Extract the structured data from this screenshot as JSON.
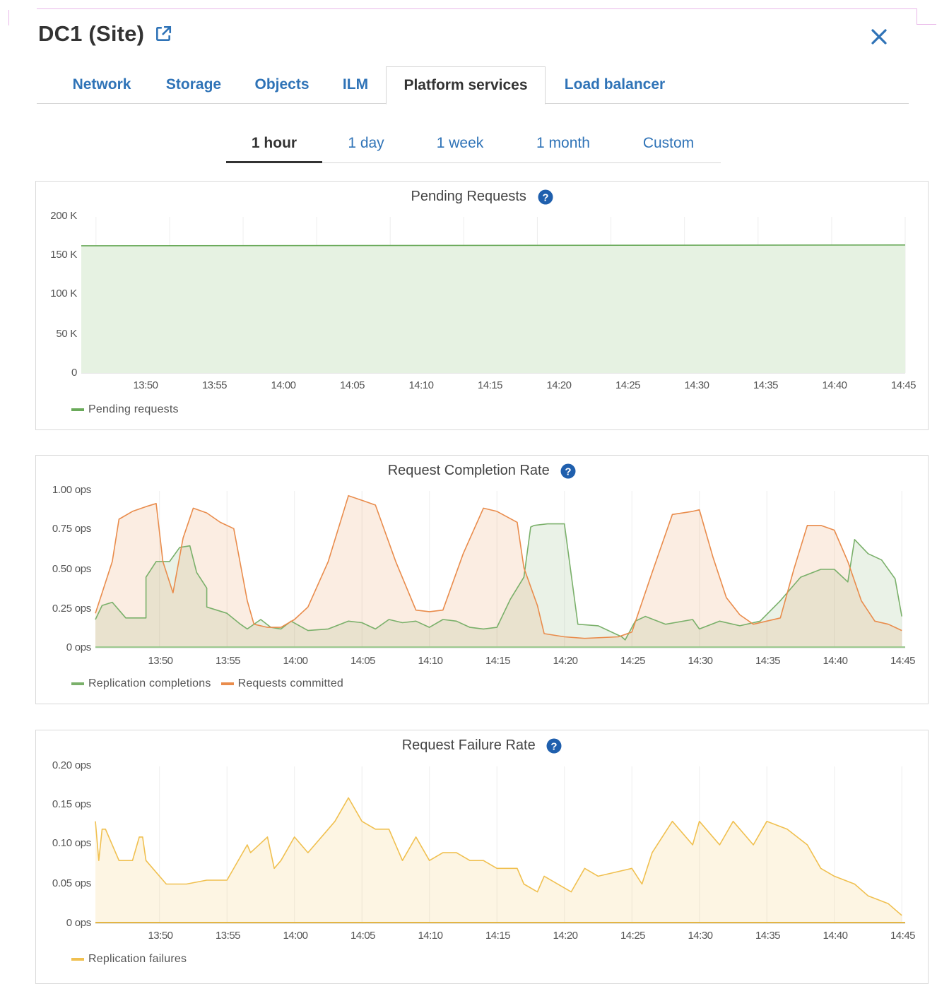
{
  "header": {
    "title": "DC1 (Site)",
    "external_link_icon": "external-link-icon",
    "close_icon": "close-icon",
    "accent_color": "#2f73b7"
  },
  "tabs": [
    {
      "label": "Network",
      "active": false
    },
    {
      "label": "Storage",
      "active": false
    },
    {
      "label": "Objects",
      "active": false
    },
    {
      "label": "ILM",
      "active": false
    },
    {
      "label": "Platform services",
      "active": true
    },
    {
      "label": "Load balancer",
      "active": false
    }
  ],
  "time_ranges": [
    {
      "label": "1 hour",
      "active": true
    },
    {
      "label": "1 day",
      "active": false
    },
    {
      "label": "1 week",
      "active": false
    },
    {
      "label": "1 month",
      "active": false
    },
    {
      "label": "Custom",
      "active": false
    }
  ],
  "chart_data": [
    {
      "type": "area",
      "title": "Pending Requests",
      "help_icon": "help-icon",
      "y_tick_labels": [
        "200 K",
        "150 K",
        "100 K",
        "50 K",
        "0"
      ],
      "ylim": [
        0,
        200000
      ],
      "x_tick_labels": [
        "13:50",
        "13:55",
        "14:00",
        "14:05",
        "14:10",
        "14:15",
        "14:20",
        "14:25",
        "14:30",
        "14:35",
        "14:40",
        "14:45"
      ],
      "xlim": [
        -0.2,
        11
      ],
      "series": [
        {
          "name": "Pending requests",
          "color": "#6aaa5a",
          "fill": "#e6f2e2",
          "x": [
            -0.2,
            11
          ],
          "values": [
            163000,
            164000
          ]
        }
      ],
      "legend": "bottom-left"
    },
    {
      "type": "area",
      "title": "Request Completion Rate",
      "help_icon": "help-icon",
      "y_tick_labels": [
        "1.00 ops",
        "0.75 ops",
        "0.50 ops",
        "0.25 ops",
        "0 ops"
      ],
      "ylim": [
        0,
        1
      ],
      "x_tick_labels": [
        "13:50",
        "13:55",
        "14:00",
        "14:05",
        "14:10",
        "14:15",
        "14:20",
        "14:25",
        "14:30",
        "14:35",
        "14:40",
        "14:45"
      ],
      "xlim": [
        -0.95,
        11.05
      ],
      "series": [
        {
          "name": "Replication completions",
          "color": "#7ab06a",
          "fill": "rgba(122,176,106,0.16)",
          "x": [
            -0.95,
            -0.85,
            -0.7,
            -0.5,
            -0.35,
            -0.2,
            -0.2,
            -0.05,
            0.15,
            0.3,
            0.45,
            0.55,
            0.7,
            0.7,
            1.0,
            1.2,
            1.3,
            1.5,
            1.65,
            1.8,
            1.95,
            2.2,
            2.5,
            2.8,
            3.0,
            3.2,
            3.4,
            3.6,
            3.8,
            4.0,
            4.2,
            4.4,
            4.6,
            4.8,
            5.0,
            5.2,
            5.4,
            5.5,
            5.55,
            5.75,
            6.0,
            6.2,
            6.5,
            6.85,
            6.9,
            7.05,
            7.2,
            7.5,
            7.9,
            8.0,
            8.3,
            8.6,
            8.9,
            9.2,
            9.5,
            9.8,
            10.0,
            10.2,
            10.3,
            10.5,
            10.7,
            10.9,
            11.0
          ],
          "values": [
            0.18,
            0.27,
            0.29,
            0.19,
            0.19,
            0.19,
            0.45,
            0.55,
            0.55,
            0.64,
            0.65,
            0.48,
            0.38,
            0.26,
            0.22,
            0.15,
            0.12,
            0.18,
            0.13,
            0.12,
            0.17,
            0.11,
            0.12,
            0.17,
            0.16,
            0.12,
            0.18,
            0.16,
            0.17,
            0.13,
            0.18,
            0.17,
            0.13,
            0.12,
            0.13,
            0.31,
            0.45,
            0.77,
            0.78,
            0.79,
            0.79,
            0.15,
            0.14,
            0.07,
            0.05,
            0.17,
            0.2,
            0.15,
            0.18,
            0.12,
            0.17,
            0.14,
            0.17,
            0.3,
            0.45,
            0.5,
            0.5,
            0.42,
            0.69,
            0.6,
            0.56,
            0.44,
            0.2
          ]
        },
        {
          "name": "Requests committed",
          "color": "#e98c4c",
          "fill": "rgba(233,140,76,0.16)",
          "x": [
            -0.95,
            -0.85,
            -0.7,
            -0.6,
            -0.4,
            -0.2,
            -0.05,
            0.05,
            0.2,
            0.35,
            0.5,
            0.7,
            0.9,
            1.1,
            1.3,
            1.4,
            1.6,
            1.8,
            2.0,
            2.2,
            2.5,
            2.8,
            3.0,
            3.2,
            3.5,
            3.8,
            4.0,
            4.2,
            4.5,
            4.8,
            5.0,
            5.3,
            5.4,
            5.6,
            5.7,
            6.0,
            6.3,
            6.8,
            7.0,
            7.3,
            7.6,
            7.9,
            8.0,
            8.2,
            8.4,
            8.6,
            8.8,
            9.2,
            9.4,
            9.6,
            9.8,
            10.0,
            10.2,
            10.4,
            10.6,
            10.8,
            11.0
          ],
          "values": [
            0.22,
            0.35,
            0.55,
            0.82,
            0.87,
            0.9,
            0.92,
            0.55,
            0.35,
            0.7,
            0.89,
            0.86,
            0.8,
            0.76,
            0.3,
            0.15,
            0.13,
            0.13,
            0.18,
            0.26,
            0.55,
            0.97,
            0.94,
            0.91,
            0.55,
            0.24,
            0.23,
            0.24,
            0.6,
            0.89,
            0.87,
            0.8,
            0.51,
            0.27,
            0.09,
            0.07,
            0.06,
            0.07,
            0.1,
            0.48,
            0.85,
            0.87,
            0.88,
            0.58,
            0.32,
            0.21,
            0.15,
            0.19,
            0.5,
            0.78,
            0.78,
            0.75,
            0.55,
            0.3,
            0.17,
            0.15,
            0.11
          ]
        }
      ],
      "legend": "bottom-left"
    },
    {
      "type": "area",
      "title": "Request Failure Rate",
      "help_icon": "help-icon",
      "y_tick_labels": [
        "0.20 ops",
        "0.15 ops",
        "0.10 ops",
        "0.05 ops",
        "0 ops"
      ],
      "ylim": [
        0,
        0.2
      ],
      "x_tick_labels": [
        "13:50",
        "13:55",
        "14:00",
        "14:05",
        "14:10",
        "14:15",
        "14:20",
        "14:25",
        "14:30",
        "14:35",
        "14:40",
        "14:45"
      ],
      "xlim": [
        -0.95,
        11.05
      ],
      "series": [
        {
          "name": "Replication failures",
          "color": "#f0c050",
          "fill": "rgba(240,192,80,0.16)",
          "x": [
            -0.95,
            -0.9,
            -0.85,
            -0.8,
            -0.6,
            -0.4,
            -0.3,
            -0.25,
            -0.2,
            -0.1,
            0.1,
            0.2,
            0.4,
            0.7,
            1.0,
            1.3,
            1.35,
            1.6,
            1.7,
            1.8,
            2.0,
            2.2,
            2.5,
            2.6,
            2.8,
            3.0,
            3.2,
            3.4,
            3.6,
            3.8,
            4.0,
            4.2,
            4.4,
            4.6,
            4.8,
            5.0,
            5.3,
            5.4,
            5.6,
            5.7,
            6.1,
            6.3,
            6.5,
            7.0,
            7.15,
            7.3,
            7.6,
            7.9,
            8.0,
            8.3,
            8.5,
            8.8,
            9.0,
            9.3,
            9.6,
            9.8,
            10.0,
            10.3,
            10.5,
            10.8,
            11.0
          ],
          "values": [
            0.13,
            0.08,
            0.12,
            0.12,
            0.08,
            0.08,
            0.11,
            0.11,
            0.08,
            0.07,
            0.05,
            0.05,
            0.05,
            0.055,
            0.055,
            0.1,
            0.09,
            0.11,
            0.07,
            0.08,
            0.11,
            0.09,
            0.12,
            0.13,
            0.16,
            0.13,
            0.12,
            0.12,
            0.08,
            0.11,
            0.08,
            0.09,
            0.09,
            0.08,
            0.08,
            0.07,
            0.07,
            0.05,
            0.04,
            0.06,
            0.04,
            0.07,
            0.06,
            0.07,
            0.05,
            0.09,
            0.13,
            0.1,
            0.13,
            0.1,
            0.13,
            0.1,
            0.13,
            0.12,
            0.1,
            0.07,
            0.06,
            0.05,
            0.035,
            0.025,
            0.01
          ]
        }
      ],
      "legend": "bottom-left"
    }
  ]
}
